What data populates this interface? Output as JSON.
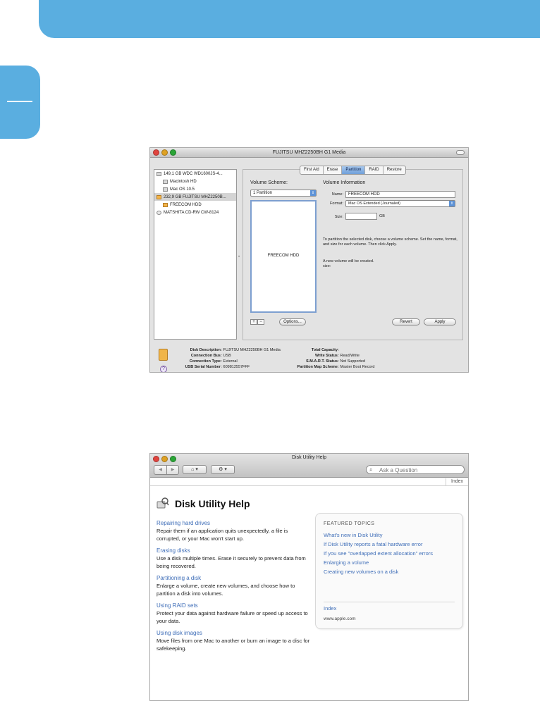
{
  "colors": {
    "banner": "#5aaee0",
    "link": "#3f6eb8",
    "close": "#e0443e",
    "minimize": "#dea123",
    "zoom": "#2aa536"
  },
  "disk_utility": {
    "title": "FUJITSU MHZ2250BH G1 Media",
    "disks": [
      {
        "label": "149,1 GB WDC WD1600JS-4...",
        "icon": "hard-disk-icon",
        "indent": false,
        "selected": false
      },
      {
        "label": "Macintosh HD",
        "icon": "volume-icon",
        "indent": true,
        "selected": false
      },
      {
        "label": "Mac OS 10.5",
        "icon": "volume-icon",
        "indent": true,
        "selected": false
      },
      {
        "label": "232,9 GB FUJITSU MHZ2250B...",
        "icon": "external-disk-icon",
        "indent": false,
        "selected": true
      },
      {
        "label": "FREECOM HDD",
        "icon": "external-volume-icon",
        "indent": true,
        "selected": false
      },
      {
        "label": "MATSHITA CD-RW CW-8124",
        "icon": "cd-drive-icon",
        "indent": false,
        "selected": false
      }
    ],
    "tabs": [
      "First Aid",
      "Erase",
      "Partition",
      "RAID",
      "Restore"
    ],
    "active_tab": "Partition",
    "volume_scheme_label": "Volume Scheme:",
    "volume_scheme_value": "1 Partition",
    "partition_name": "FREECOM HDD",
    "volume_info_label": "Volume Information",
    "name_label": "Name:",
    "name_value": "FREECOM HDD",
    "format_label": "Format:",
    "format_value": "Mac OS Extended (Journaled)",
    "size_label": "Size:",
    "size_unit": "GB",
    "instructions": "To partition the selected disk, choose a volume scheme. Set the name, format, and size for each volume. Then click Apply.",
    "new_volume_text": "A new volume will be created.",
    "size_text": "size:",
    "plus": "+",
    "minus": "−",
    "options_button": "Options...",
    "revert_button": "Revert",
    "apply_button": "Apply",
    "info_left": [
      {
        "key": "Disk Description",
        "value": "FUJITSU MHZ2250BH G1 Media"
      },
      {
        "key": "Connection Bus",
        "value": "USB"
      },
      {
        "key": "Connection Type",
        "value": "External"
      },
      {
        "key": "USB Serial Number",
        "value": "609812557FFF"
      }
    ],
    "info_right": [
      {
        "key": "Total Capacity",
        "value": ""
      },
      {
        "key": "Write Status",
        "value": "Read/Write"
      },
      {
        "key": "S.M.A.R.T. Status",
        "value": "Not Supported"
      },
      {
        "key": "Partition Map Scheme",
        "value": "Master Boot Record"
      }
    ]
  },
  "help_window": {
    "title": "Disk Utility Help",
    "back": "◀",
    "forward": "▶",
    "home_button": "⌂ ▾",
    "action_button": "⚙ ▾",
    "search_placeholder": "Ask a Question",
    "index_link": "Index",
    "heading": "Disk Utility Help",
    "topics": [
      {
        "title": "Repairing hard drives",
        "desc": "Repair them if an application quits unexpectedly, a file is corrupted, or your Mac won't start up."
      },
      {
        "title": "Erasing disks",
        "desc": "Use a disk multiple times. Erase it securely to prevent data from being recovered."
      },
      {
        "title": "Partitioning a disk",
        "desc": "Enlarge a volume, create new volumes, and choose how to partition a disk into volumes."
      },
      {
        "title": "Using RAID sets",
        "desc": "Protect your data against hardware failure or speed up access to your data."
      },
      {
        "title": "Using disk images",
        "desc": "Move files from one Mac to another or burn an image to a disc for safekeeping."
      }
    ],
    "featured_heading": "FEATURED TOPICS",
    "featured": [
      "What's new in Disk Utility",
      "If Disk Utility reports a fatal hardware error",
      "If you see \"overlapped extent allocation\" errors",
      "Enlarging a volume",
      "Creating new volumes on a disk"
    ],
    "featured_index": "Index",
    "website": "www.apple.com"
  }
}
